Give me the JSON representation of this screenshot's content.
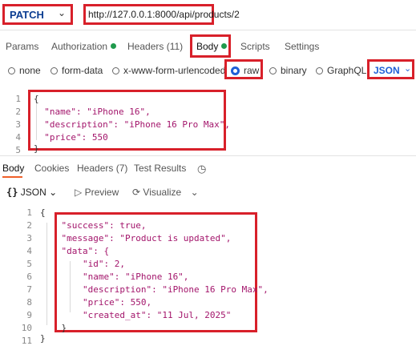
{
  "request": {
    "method": "PATCH",
    "url": "http://127.0.0.1:8000/api/products/2"
  },
  "request_tabs": [
    {
      "label": "Params"
    },
    {
      "label": "Authorization",
      "dot": true
    },
    {
      "label": "Headers (11)"
    },
    {
      "label": "Body",
      "dot": true,
      "active": true
    },
    {
      "label": "Scripts"
    },
    {
      "label": "Settings"
    }
  ],
  "body_types": [
    "none",
    "form-data",
    "x-www-form-urlencoded",
    "raw",
    "binary",
    "GraphQL"
  ],
  "body_type_selected": "raw",
  "body_format": "JSON",
  "request_body_lines": [
    {
      "num": "1",
      "text": "{"
    },
    {
      "num": "2",
      "text": "  \"name\": \"iPhone 16\","
    },
    {
      "num": "3",
      "text": "  \"description\": \"iPhone 16 Pro Max\","
    },
    {
      "num": "4",
      "text": "  \"price\": 550"
    },
    {
      "num": "5",
      "text": "}"
    }
  ],
  "response_tabs": [
    {
      "label": "Body",
      "active": true
    },
    {
      "label": "Cookies"
    },
    {
      "label": "Headers (7)"
    },
    {
      "label": "Test Results"
    }
  ],
  "response_toolbar": {
    "format": "JSON",
    "preview": "Preview",
    "visualize": "Visualize"
  },
  "response_body_lines": [
    {
      "num": "1",
      "text": "{"
    },
    {
      "num": "2",
      "text": "    \"success\": true,"
    },
    {
      "num": "3",
      "text": "    \"message\": \"Product is updated\","
    },
    {
      "num": "4",
      "text": "    \"data\": {"
    },
    {
      "num": "5",
      "text": "        \"id\": 2,"
    },
    {
      "num": "6",
      "text": "        \"name\": \"iPhone 16\","
    },
    {
      "num": "7",
      "text": "        \"description\": \"iPhone 16 Pro Max\","
    },
    {
      "num": "8",
      "text": "        \"price\": 550,"
    },
    {
      "num": "9",
      "text": "        \"created_at\": \"11 Jul, 2025\""
    },
    {
      "num": "10",
      "text": "    }"
    },
    {
      "num": "11",
      "text": "}"
    }
  ],
  "highlight_color": "#d8202a"
}
